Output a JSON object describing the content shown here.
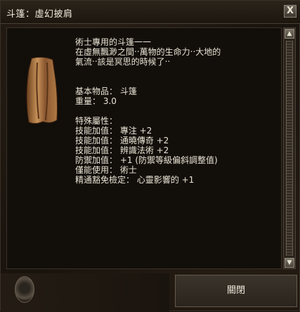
{
  "window": {
    "title": "斗篷：虛幻披肩",
    "close_icon": "close-icon"
  },
  "item": {
    "icon": "cloak-icon",
    "lines": [
      "術士專用的斗篷一一",
      "在虛無飄渺之間‧‧萬物的生命力‧‧大地的",
      "氣流‧‧該是冥思的時候了‧‧",
      "",
      "基本物品： 斗篷",
      "重量： 3.0",
      "",
      "特殊屬性：",
      "技能加值： 專注 +2",
      "技能加值： 通曉傳奇 +2",
      "技能加值： 辨識法術 +2",
      "防禦加值： +1 (防禦等級偏斜調整值)",
      "僅能使用： 術士",
      "精通豁免檢定： 心靈影響的 +1"
    ]
  },
  "scrollbar": {
    "up_icon": "scroll-up-icon",
    "down_icon": "scroll-down-icon"
  },
  "footer": {
    "close_button_label": "關閉"
  }
}
